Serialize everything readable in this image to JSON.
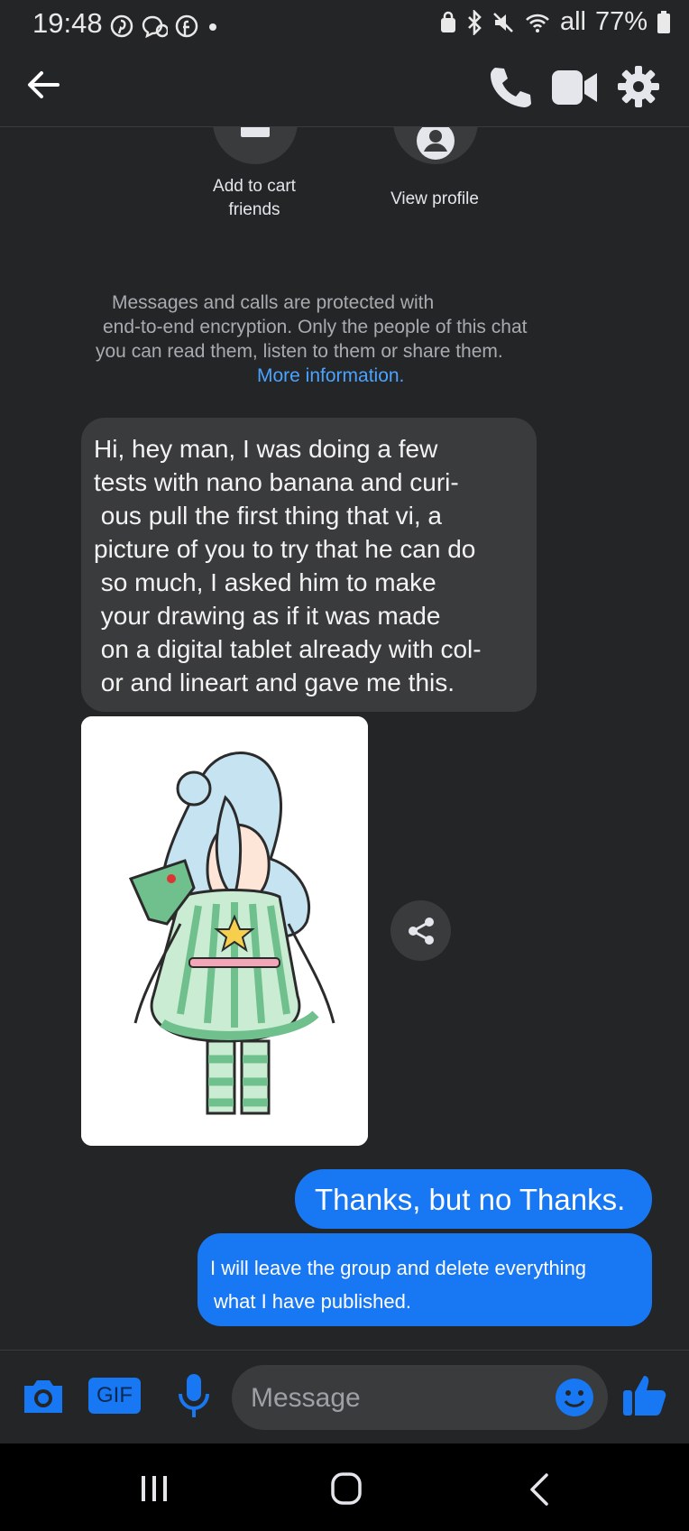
{
  "status_bar": {
    "time": "19:48",
    "signal": "all",
    "battery": "77%",
    "left_icons": [
      "pinterest-icon",
      "messenger-icon",
      "facebook-icon",
      "dot-icon"
    ],
    "right_icons": [
      "vpn-lock-icon",
      "bluetooth-icon",
      "mute-icon",
      "wifi-icon",
      "signal-icon",
      "battery-icon"
    ]
  },
  "header": {
    "back_icon": "arrow-left-icon",
    "call_icon": "phone-icon",
    "video_icon": "video-icon",
    "settings_icon": "gear-icon"
  },
  "profile_actions": {
    "add_label": "Add to cart\nfriends",
    "view_label": "View profile"
  },
  "encryption": {
    "text": "Messages and calls are protected with end-to-end encryption. Only the people of this chat you can read them, listen to them or share them.",
    "line1": "Messages and calls are protected with",
    "line2": "end-to-end encryption. Only the people of this chat",
    "line3": "you can read them, listen to them or share them.",
    "link": "More information."
  },
  "messages": {
    "incoming_text_lines": [
      "Hi, hey man, I was doing a few",
      "tests with nano banana and curi-",
      " ous pull the first thing that vi, a",
      "picture of you to try that he can do",
      " so much, I asked him to make",
      " your drawing as if it was made",
      " on a digital tablet already with col-",
      " or and lineart and gave me this."
    ],
    "outgoing_1": "Thanks, but no Thanks.",
    "outgoing_2_line1": "I will leave the group and delete everything",
    "outgoing_2_line2": "what I have published."
  },
  "composer": {
    "placeholder": "Message",
    "gif_label": "GIF"
  },
  "colors": {
    "background": "#242526",
    "bubble_in": "#3a3b3c",
    "bubble_out": "#1877f2",
    "accent": "#1877f2",
    "link": "#4aa3ff"
  }
}
